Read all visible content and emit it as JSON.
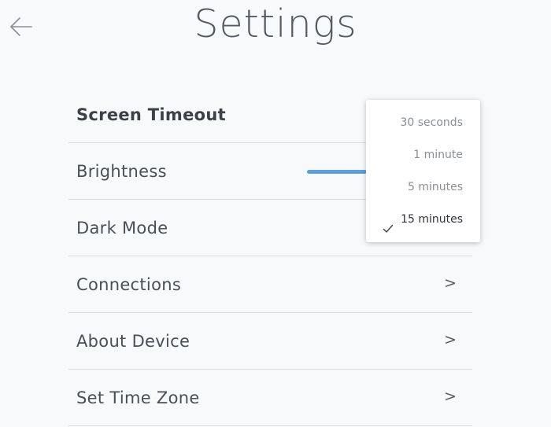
{
  "header": {
    "title": "Settings",
    "back_icon": "arrow-left-icon"
  },
  "settings": [
    {
      "label": "Screen Timeout",
      "control": "dropdown",
      "active": true
    },
    {
      "label": "Brightness",
      "control": "slider"
    },
    {
      "label": "Dark Mode",
      "control": "toggle"
    },
    {
      "label": "Connections",
      "chevron": ">"
    },
    {
      "label": "About Device",
      "chevron": ">"
    },
    {
      "label": "Set Time Zone",
      "chevron": ">"
    }
  ],
  "timeout_menu": {
    "options": [
      "30 seconds",
      "1 minute",
      "5 minutes",
      "15 minutes"
    ],
    "selected": "15 minutes",
    "check_icon": "checkmark-icon"
  },
  "colors": {
    "background": "#f8f9fb",
    "slider_accent": "#5aa0e0",
    "divider": "#d9dce0",
    "text": "#4a4f56"
  }
}
